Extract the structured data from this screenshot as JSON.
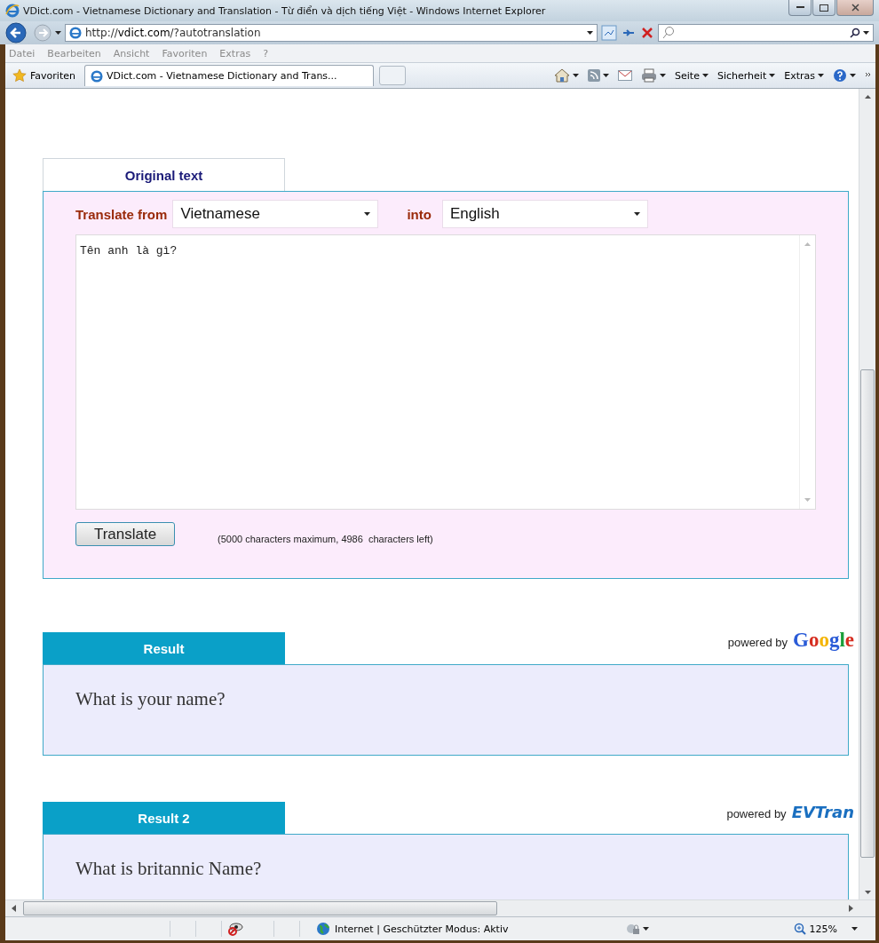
{
  "window": {
    "title": "VDict.com - Vietnamese Dictionary and Translation - Từ điển và dịch tiếng Việt - Windows Internet Explorer"
  },
  "address_bar": {
    "url": "http://**vdict.com**/?autotranslation"
  },
  "menu": [
    "Datei",
    "Bearbeiten",
    "Ansicht",
    "Favoriten",
    "Extras",
    "?"
  ],
  "favorites": "Favoriten",
  "tabs": [
    {
      "label": "VDict.com - Vietnamese Dictionary and Trans...",
      "selected": true
    }
  ],
  "command_bar": [
    "Seite",
    "Sicherheit",
    "Extras"
  ],
  "translator": {
    "tab": "Original text",
    "from_label": "Translate from",
    "from_value": "Vietnamese",
    "into_label": "into",
    "into_value": "English",
    "source_text": "Tên anh là gì?",
    "button": "Translate",
    "note": "(5000 characters maximum, 4986  characters left)"
  },
  "results": [
    {
      "tab": "Result",
      "powered_by": "powered by",
      "provider": "Google",
      "kind": "google",
      "text": "What is your name?"
    },
    {
      "tab": "Result 2",
      "powered_by": "powered by",
      "provider": "EVTran",
      "kind": "evtran",
      "text": "What is britannic Name?"
    }
  ],
  "status_bar": {
    "zone": "Internet | Geschützter Modus: Aktiv",
    "zoom": "125%"
  }
}
